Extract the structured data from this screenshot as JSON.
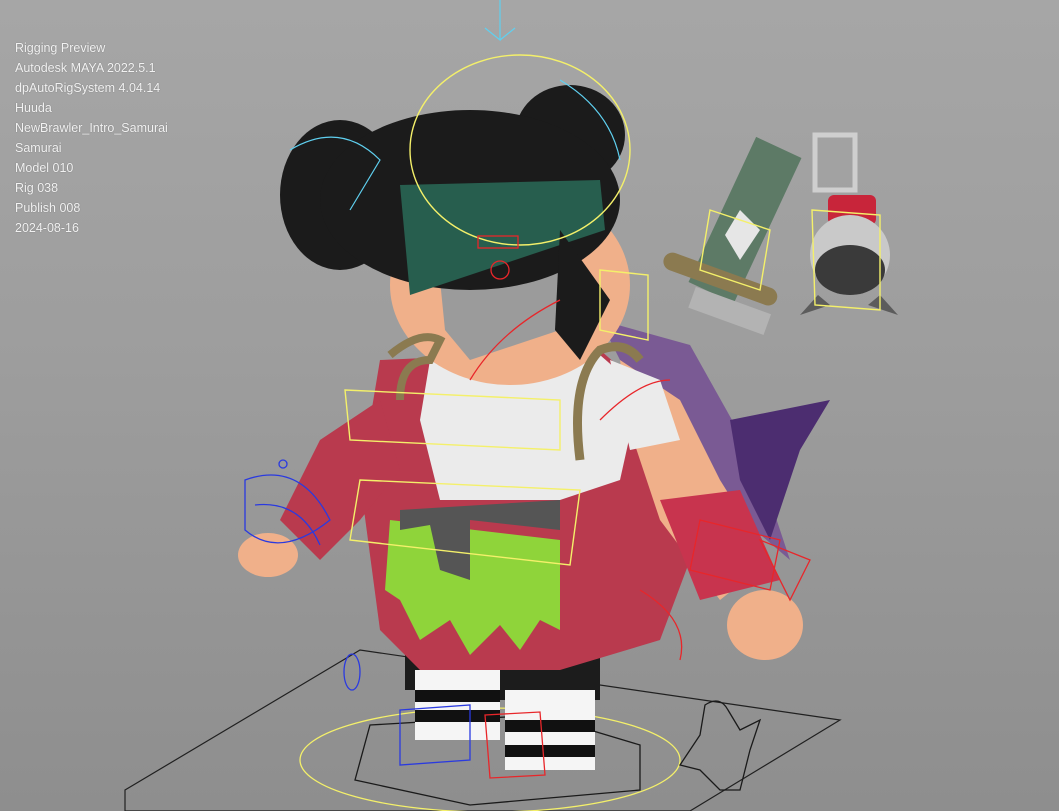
{
  "hud": {
    "lines": [
      "Rigging Preview",
      "Autodesk MAYA 2022.5.1",
      "dpAutoRigSystem 4.04.14",
      "Huuda",
      "NewBrawler_Intro_Samurai",
      "Samurai",
      "Model 010",
      "Rig 038",
      "Publish 008",
      "2024-08-16"
    ]
  },
  "colors": {
    "background": "#9d9d9d",
    "control_yellow": "#f4f06a",
    "control_red": "#e8262a",
    "control_blue": "#2a3ae0",
    "control_cyan": "#5fd0f0",
    "robe": "#b93a4e",
    "skirt": "#8fd43a",
    "headband": "#275e4e",
    "hair": "#1b1b1b",
    "skin": "#f0b08a",
    "sword": "#5d7a66",
    "cape": "#6a4a8a"
  }
}
